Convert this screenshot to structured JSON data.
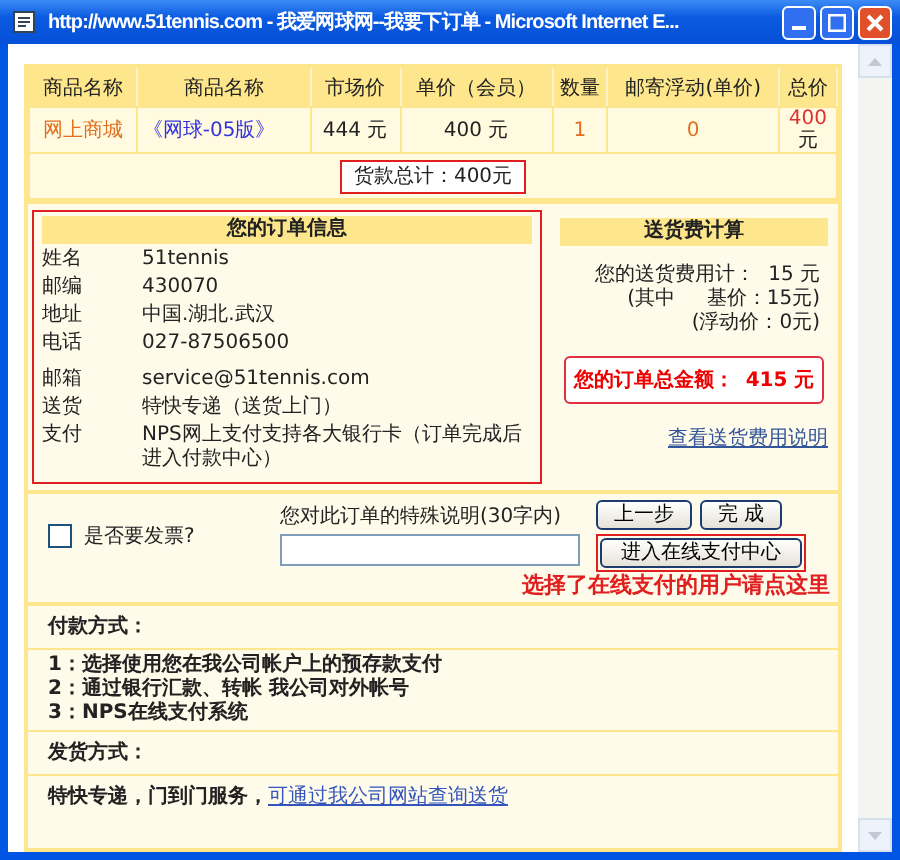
{
  "window": {
    "title": "http://www.51tennis.com - 我爱网球网--我要下订单 - Microsoft Internet E..."
  },
  "product_table": {
    "columns": [
      "商品名称",
      "商品名称",
      "市场价",
      "单价（会员）",
      "数量",
      "邮寄浮动(单价)",
      "总价"
    ],
    "rows": [
      [
        {
          "kind": "shop",
          "text": "网上商城"
        },
        {
          "kind": "link",
          "text": "《网球-05版》"
        },
        {
          "kind": "plain",
          "text": "444 元"
        },
        {
          "kind": "plain",
          "text": "400 元"
        },
        {
          "kind": "accent",
          "text": "1"
        },
        {
          "kind": "accent",
          "text": "0"
        },
        {
          "kind": "total",
          "text": "400",
          "unit": "元"
        }
      ]
    ],
    "subtotal": "货款总计：400元"
  },
  "order_info": {
    "title": "您的订单信息",
    "fields": [
      {
        "label": "姓名",
        "value": "51tennis"
      },
      {
        "label": "邮编",
        "value": "430070"
      },
      {
        "label": "地址",
        "value": "中国.湖北.武汉"
      },
      {
        "label": "电话",
        "value": "027-87506500"
      },
      {
        "label": "邮箱",
        "value": "service@51tennis.com"
      },
      {
        "label": "送货",
        "value": "特快专递（送货上门）"
      },
      {
        "label": "支付",
        "value": "NPS网上支付支持各大银行卡（订单完成后进入付款中心）"
      }
    ]
  },
  "shipping_calc": {
    "title": "送货费计算",
    "lines": [
      "您的送货费用计：  15 元",
      "(其中     基价：15元)",
      "(浮动价：0元)"
    ],
    "total_label": "您的订单总金额：",
    "total_value": "415 元",
    "link": "查看送货费用说明"
  },
  "invoice": {
    "label": "是否要发票?",
    "checked": false
  },
  "remark": {
    "label": "您对此订单的特殊说明(30字内)"
  },
  "buttons": {
    "back": "上一步",
    "finish": "完 成",
    "pay_center": "进入在线支付中心"
  },
  "pay_hint": "选择了在线支付的用户请点这里",
  "payment": {
    "title": "付款方式：",
    "methods": [
      "1：选择使用您在我公司帐户上的预存款支付",
      "2：通过银行汇款、转帐 我公司对外帐号",
      "3：NPS在线支付系统"
    ]
  },
  "delivery": {
    "title": "发货方式：",
    "text": "特快专递，门到门服务，",
    "link": "可通过我公司网站查询送货"
  }
}
